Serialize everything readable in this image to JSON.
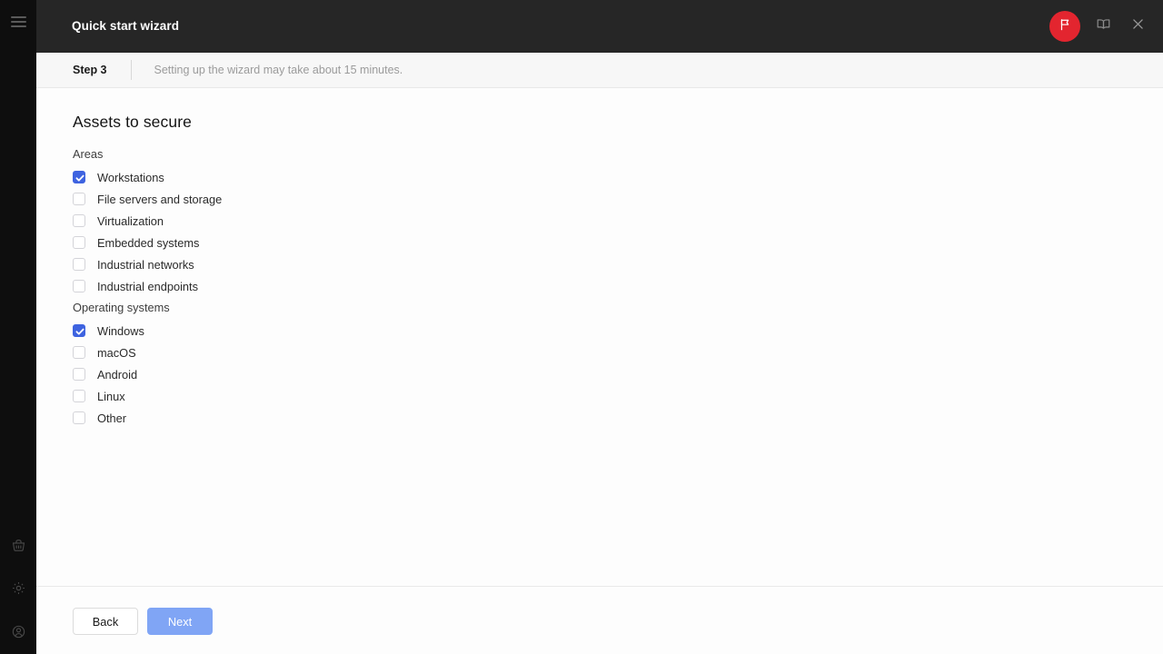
{
  "window": {
    "title": "Quick start wizard",
    "header_actions": [
      {
        "name": "flag-badge",
        "icon": "flag-icon"
      },
      {
        "name": "help-book-button",
        "icon": "book-icon"
      },
      {
        "name": "close-button",
        "icon": "close-icon"
      }
    ]
  },
  "sidebar": {
    "menu_icon": "hamburger-icon",
    "items": [
      {
        "name": "marketplace",
        "icon": "basket-icon"
      },
      {
        "name": "settings",
        "icon": "gear-icon"
      },
      {
        "name": "account",
        "icon": "user-icon"
      }
    ]
  },
  "stepbar": {
    "step_label": "Step 3",
    "note": "Setting up the wizard may take about 15 minutes."
  },
  "main": {
    "title": "Assets to secure",
    "groups": [
      {
        "label": "Areas",
        "options": [
          {
            "label": "Workstations",
            "checked": true
          },
          {
            "label": "File servers and storage",
            "checked": false
          },
          {
            "label": "Virtualization",
            "checked": false
          },
          {
            "label": "Embedded systems",
            "checked": false
          },
          {
            "label": "Industrial networks",
            "checked": false
          },
          {
            "label": "Industrial endpoints",
            "checked": false
          }
        ]
      },
      {
        "label": "Operating systems",
        "options": [
          {
            "label": "Windows",
            "checked": true
          },
          {
            "label": "macOS",
            "checked": false
          },
          {
            "label": "Android",
            "checked": false
          },
          {
            "label": "Linux",
            "checked": false
          },
          {
            "label": "Other",
            "checked": false
          }
        ]
      }
    ]
  },
  "footer": {
    "back_label": "Back",
    "next_label": "Next",
    "next_disabled": true
  },
  "colors": {
    "accent_blue": "#3e63e0",
    "next_button_blue": "#80a5f5",
    "badge_red": "#e3252f",
    "header_dark": "#262626",
    "sidebar_dark": "#0e0e0e",
    "stepbar_gray": "#f7f7f7"
  }
}
